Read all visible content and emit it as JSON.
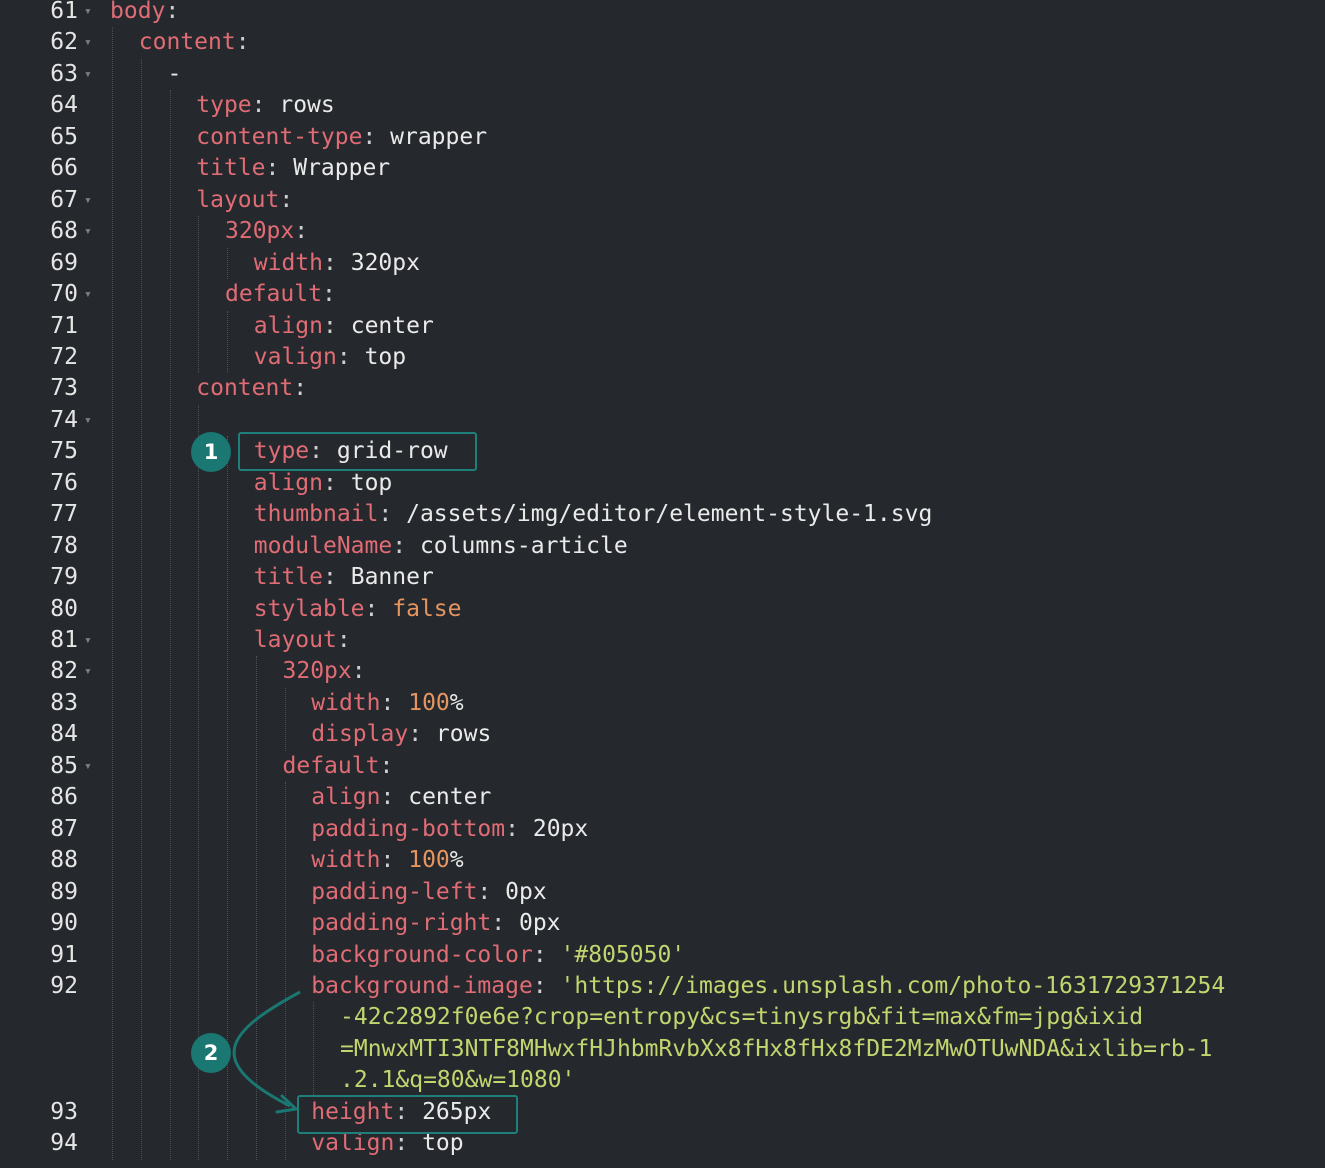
{
  "colors": {
    "background": "#25282c",
    "key": "#e06c75",
    "value": "#eaeaea",
    "number": "#e5955f",
    "string": "#c3d56f",
    "annotation": "#1a7772"
  },
  "annotations": {
    "badge1": "1",
    "badge2": "2"
  },
  "lines": [
    {
      "num": "61",
      "fold": true,
      "indent": 0,
      "key": "body",
      "value": ""
    },
    {
      "num": "62",
      "fold": true,
      "indent": 1,
      "key": "content",
      "value": ""
    },
    {
      "num": "63",
      "fold": true,
      "indent": 2,
      "dash": "-"
    },
    {
      "num": "64",
      "fold": false,
      "indent": 3,
      "key": "type",
      "value": "rows"
    },
    {
      "num": "65",
      "fold": false,
      "indent": 3,
      "key": "content-type",
      "value": "wrapper"
    },
    {
      "num": "66",
      "fold": false,
      "indent": 3,
      "key": "title",
      "value": "Wrapper"
    },
    {
      "num": "67",
      "fold": true,
      "indent": 3,
      "key": "layout",
      "value": ""
    },
    {
      "num": "68",
      "fold": true,
      "indent": 4,
      "key": "320px",
      "value": ""
    },
    {
      "num": "69",
      "fold": false,
      "indent": 5,
      "key": "width",
      "value": "320px"
    },
    {
      "num": "70",
      "fold": true,
      "indent": 4,
      "key": "default",
      "value": ""
    },
    {
      "num": "71",
      "fold": false,
      "indent": 5,
      "key": "align",
      "value": "center"
    },
    {
      "num": "72",
      "fold": false,
      "indent": 5,
      "key": "valign",
      "value": "top"
    },
    {
      "num": "73",
      "fold": false,
      "indent": 3,
      "key": "content",
      "value": ""
    },
    {
      "num": "74",
      "fold": true,
      "indent": 4,
      "dash": ""
    },
    {
      "num": "75",
      "fold": false,
      "indent": 5,
      "key": "type",
      "value": "grid-row"
    },
    {
      "num": "76",
      "fold": false,
      "indent": 5,
      "key": "align",
      "value": "top"
    },
    {
      "num": "77",
      "fold": false,
      "indent": 5,
      "key": "thumbnail",
      "value": "/assets/img/editor/element-style-1.svg"
    },
    {
      "num": "78",
      "fold": false,
      "indent": 5,
      "key": "moduleName",
      "value": "columns-article"
    },
    {
      "num": "79",
      "fold": false,
      "indent": 5,
      "key": "title",
      "value": "Banner"
    },
    {
      "num": "80",
      "fold": false,
      "indent": 5,
      "key": "stylable",
      "value": "false",
      "vtype": "number"
    },
    {
      "num": "81",
      "fold": true,
      "indent": 5,
      "key": "layout",
      "value": ""
    },
    {
      "num": "82",
      "fold": true,
      "indent": 6,
      "key": "320px",
      "value": ""
    },
    {
      "num": "83",
      "fold": false,
      "indent": 7,
      "key": "width",
      "value": "100",
      "suffix": "%",
      "vtype": "number"
    },
    {
      "num": "84",
      "fold": false,
      "indent": 7,
      "key": "display",
      "value": "rows"
    },
    {
      "num": "85",
      "fold": true,
      "indent": 6,
      "key": "default",
      "value": ""
    },
    {
      "num": "86",
      "fold": false,
      "indent": 7,
      "key": "align",
      "value": "center"
    },
    {
      "num": "87",
      "fold": false,
      "indent": 7,
      "key": "padding-bottom",
      "value": "20px"
    },
    {
      "num": "88",
      "fold": false,
      "indent": 7,
      "key": "width",
      "value": "100",
      "suffix": "%",
      "vtype": "number"
    },
    {
      "num": "89",
      "fold": false,
      "indent": 7,
      "key": "padding-left",
      "value": "0px"
    },
    {
      "num": "90",
      "fold": false,
      "indent": 7,
      "key": "padding-right",
      "value": "0px"
    },
    {
      "num": "91",
      "fold": false,
      "indent": 7,
      "key": "background-color",
      "value": "'#805050'",
      "vtype": "string"
    },
    {
      "num": "92",
      "fold": false,
      "indent": 7,
      "key": "background-image",
      "value": "'https://images.unsplash.com/photo-1631729371254",
      "vtype": "string"
    },
    {
      "num": "",
      "fold": false,
      "indent": 8,
      "cont": "-42c2892f0e6e?crop=entropy&cs=tinysrgb&fit=max&fm=jpg&ixid"
    },
    {
      "num": "",
      "fold": false,
      "indent": 8,
      "cont": "=MnwxMTI3NTF8MHwxfHJhbmRvbXx8fHx8fHx8fDE2MzMwOTUwNDA&ixlib=rb-1"
    },
    {
      "num": "",
      "fold": false,
      "indent": 8,
      "cont": ".2.1&q=80&w=1080'"
    },
    {
      "num": "93",
      "fold": false,
      "indent": 7,
      "key": "height",
      "value": "265px"
    },
    {
      "num": "94",
      "fold": false,
      "indent": 7,
      "key": "valign",
      "value": "top"
    }
  ]
}
